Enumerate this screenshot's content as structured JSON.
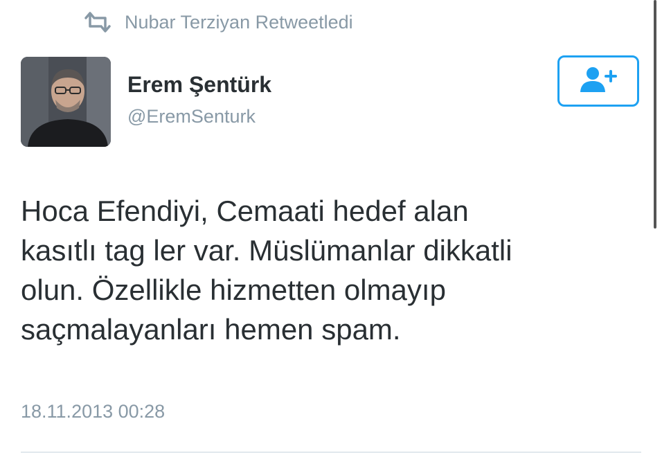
{
  "retweet": {
    "icon": "retweet-icon",
    "text": "Nubar Terziyan Retweetledi"
  },
  "user": {
    "display_name": "Erem Şentürk",
    "handle": "@EremSenturk",
    "avatar": "avatar"
  },
  "follow_button": {
    "icon": "follow-user-icon"
  },
  "tweet": {
    "text": "Hoca Efendiyi, Cemaati hedef alan\nkasıtlı tag ler var. Müslümanlar dikkatli\nolun. Özellikle hizmetten olmayıp\nsaçmalayanları hemen spam.",
    "timestamp": "18.11.2013 00:28"
  },
  "colors": {
    "accent": "#1da1f2",
    "muted_text": "#8899a6",
    "body_text": "#292f33",
    "divider": "#e1e8ed"
  }
}
